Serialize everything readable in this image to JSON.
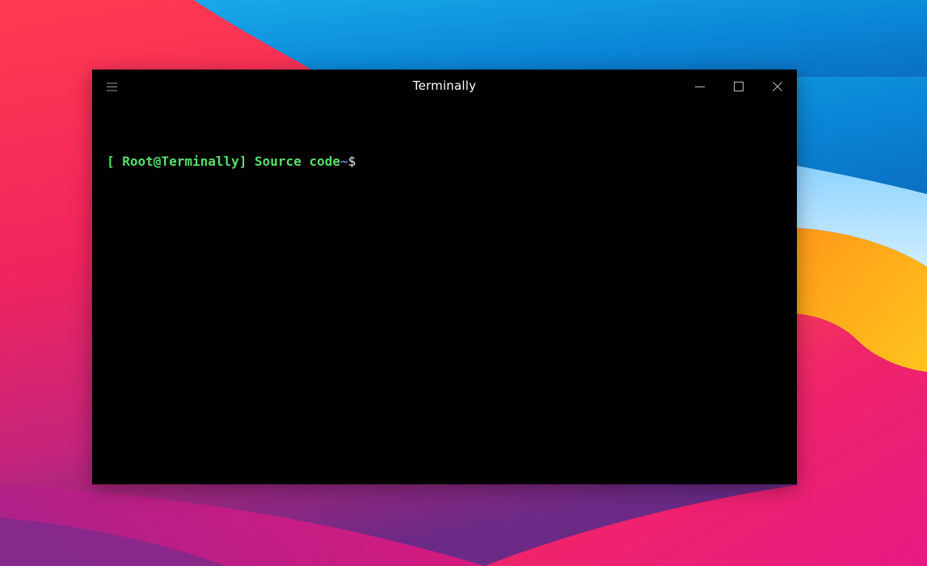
{
  "window": {
    "title": "Terminally"
  },
  "titlebar": {
    "menu_icon": "hamburger-menu-icon",
    "minimize_icon": "minimize-icon",
    "maximize_icon": "maximize-icon",
    "close_icon": "close-icon"
  },
  "terminal": {
    "prompt_user": "[ Root@Terminally] Source code",
    "prompt_path": "~",
    "prompt_symbol": "$"
  },
  "colors": {
    "window_background": "#000000",
    "prompt_user": "#55e06a",
    "prompt_path": "#6f86c9",
    "prompt_symbol": "#e8e8e8",
    "title_text": "#ffffff"
  }
}
